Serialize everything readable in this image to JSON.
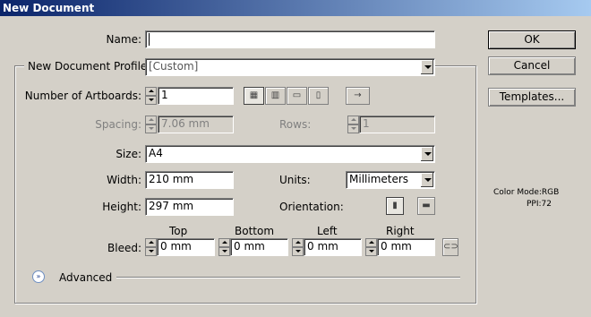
{
  "window": {
    "title": "New Document"
  },
  "name": {
    "label": "Name:",
    "value": ""
  },
  "profile": {
    "label": "New Document Profile:",
    "value": "[Custom]"
  },
  "artboards": {
    "label": "Number of Artboards:",
    "value": "1",
    "spacing_label": "Spacing:",
    "spacing_value": "7.06 mm",
    "rows_label": "Rows:",
    "rows_value": "1",
    "layout_icons": [
      "grid-by-row-icon",
      "grid-by-column-icon",
      "arrange-by-row-icon",
      "arrange-by-column-icon"
    ],
    "direction_icon": "right-arrow-icon"
  },
  "size": {
    "label": "Size:",
    "value": "A4"
  },
  "width": {
    "label": "Width:",
    "value": "210 mm"
  },
  "height": {
    "label": "Height:",
    "value": "297 mm"
  },
  "units": {
    "label": "Units:",
    "value": "Millimeters"
  },
  "orientation": {
    "label": "Orientation:",
    "options": [
      "portrait-icon",
      "landscape-icon"
    ],
    "selected": "portrait"
  },
  "bleed": {
    "label": "Bleed:",
    "top_label": "Top",
    "top": "0 mm",
    "bottom_label": "Bottom",
    "bottom": "0 mm",
    "left_label": "Left",
    "left": "0 mm",
    "right_label": "Right",
    "right": "0 mm",
    "link_icon": "chain-link-icon"
  },
  "advanced": {
    "label": "Advanced"
  },
  "buttons": {
    "ok": "OK",
    "cancel": "Cancel",
    "templates": "Templates..."
  },
  "info": {
    "color_mode": "Color Mode:RGB",
    "ppi": "PPI:72"
  }
}
